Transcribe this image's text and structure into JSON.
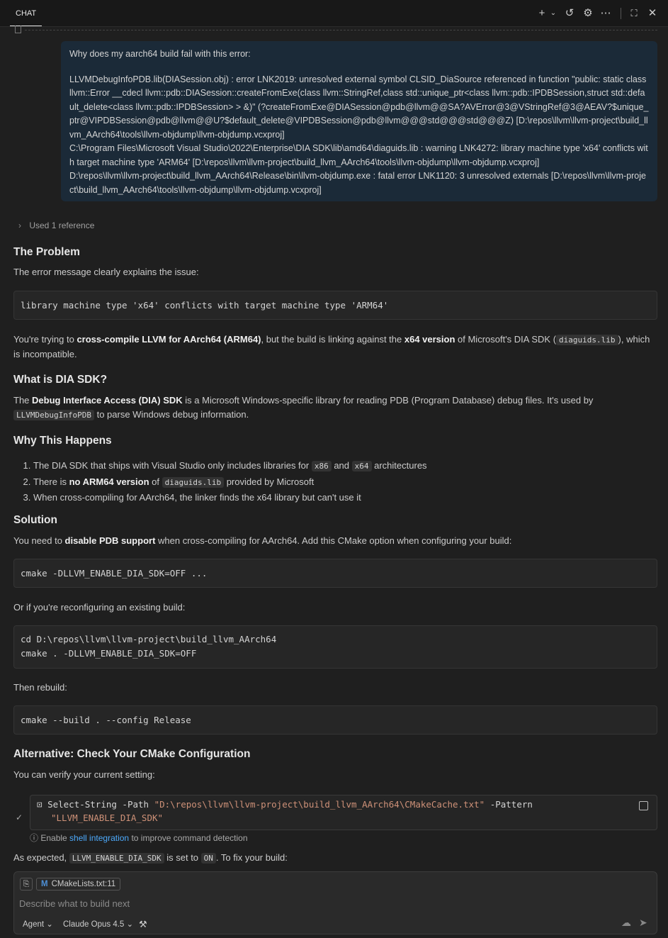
{
  "header": {
    "tab_label": "CHAT",
    "icons": [
      "add-icon",
      "chevron-down-icon",
      "history-icon",
      "gear-icon",
      "more-icon",
      "maximize-icon",
      "close-icon"
    ]
  },
  "user_message": {
    "question": "Why does my aarch64 build fail with this error:",
    "error_text": "LLVMDebugInfoPDB.lib(DIASession.obj) : error LNK2019: unresolved external symbol CLSID_DiaSource referenced in function \"public: static class llvm::Error __cdecl llvm::pdb::DIASession::createFromExe(class llvm::StringRef,class std::unique_ptr<class llvm::pdb::IPDBSession,struct std::default_delete<class llvm::pdb::IPDBSession> > &)\" (?createFromExe@DIASession@pdb@llvm@@SA?AVError@3@VStringRef@3@AEAV?$unique_ptr@VIPDBSession@pdb@llvm@@U?$default_delete@VIPDBSession@pdb@llvm@@@std@@@std@@@Z) [D:\\repos\\llvm\\llvm-project\\build_llvm_AArch64\\tools\\llvm-objdump\\llvm-objdump.vcxproj]",
    "warning_text": "C:\\Program Files\\Microsoft Visual Studio\\2022\\Enterprise\\DIA SDK\\lib\\amd64\\diaguids.lib : warning LNK4272: library machine type 'x64' conflicts with target machine type 'ARM64' [D:\\repos\\llvm\\llvm-project\\build_llvm_AArch64\\tools\\llvm-objdump\\llvm-objdump.vcxproj]",
    "fatal_text": "D:\\repos\\llvm\\llvm-project\\build_llvm_AArch64\\Release\\bin\\llvm-objdump.exe : fatal error LNK1120: 3 unresolved externals [D:\\repos\\llvm\\llvm-project\\build_llvm_AArch64\\tools\\llvm-objdump\\llvm-objdump.vcxproj]"
  },
  "reference_label": "Used 1 reference",
  "sections": {
    "problem": {
      "title": "The Problem",
      "intro": "The error message clearly explains the issue:",
      "code": "library machine type 'x64' conflicts with target machine type 'ARM64'",
      "para_a": "You're trying to ",
      "para_b": "cross-compile LLVM for AArch64 (ARM64)",
      "para_c": ", but the build is linking against the ",
      "para_d": "x64 version",
      "para_e": " of Microsoft's DIA SDK (",
      "para_code": "diaguids.lib",
      "para_f": "), which is incompatible."
    },
    "dia": {
      "title": "What is DIA SDK?",
      "para_a": "The ",
      "para_b": "Debug Interface Access (DIA) SDK",
      "para_c": " is a Microsoft Windows-specific library for reading PDB (Program Database) debug files. It's used by ",
      "para_code": "LLVMDebugInfoPDB",
      "para_d": " to parse Windows debug information."
    },
    "why": {
      "title": "Why This Happens",
      "item1_a": "The DIA SDK that ships with Visual Studio only includes libraries for ",
      "item1_code1": "x86",
      "item1_b": " and ",
      "item1_code2": "x64",
      "item1_c": " architectures",
      "item2_a": "There is ",
      "item2_b": "no ARM64 version",
      "item2_c": " of ",
      "item2_code": "diaguids.lib",
      "item2_d": " provided by Microsoft",
      "item3": "When cross-compiling for AArch64, the linker finds the x64 library but can't use it"
    },
    "solution": {
      "title": "Solution",
      "para_a": "You need to ",
      "para_b": "disable PDB support",
      "para_c": " when cross-compiling for AArch64. Add this CMake option when configuring your build:",
      "code1": "cmake -DLLVM_ENABLE_DIA_SDK=OFF ...",
      "reconf": "Or if you're reconfiguring an existing build:",
      "code2_l1": "cd D:\\repos\\llvm\\llvm-project\\build_llvm_AArch64",
      "code2_l2": "cmake . -DLLVM_ENABLE_DIA_SDK=OFF",
      "rebuild": "Then rebuild:",
      "code3": "cmake --build . --config Release"
    },
    "alternative": {
      "title": "Alternative: Check Your CMake Configuration",
      "intro": "You can verify your current setting:",
      "cmd": "Select-String -Path ",
      "cmd_path": "\"D:\\repos\\llvm\\llvm-project\\build_llvm_AArch64\\CMakeCache.txt\"",
      "cmd_flag": " -Pattern",
      "cmd_pattern": "\"LLVM_ENABLE_DIA_SDK\"",
      "hint_a": "Enable ",
      "hint_link": "shell integration",
      "hint_b": " to improve command detection",
      "result_a": "As expected, ",
      "result_code1": "LLVM_ENABLE_DIA_SDK",
      "result_b": " is set to ",
      "result_code2": "ON",
      "result_c": ". To fix your build:"
    }
  },
  "input": {
    "chip_label": "CMakeLists.txt:11",
    "placeholder": "Describe what to build next",
    "mode": "Agent",
    "model": "Claude Opus 4.5"
  }
}
